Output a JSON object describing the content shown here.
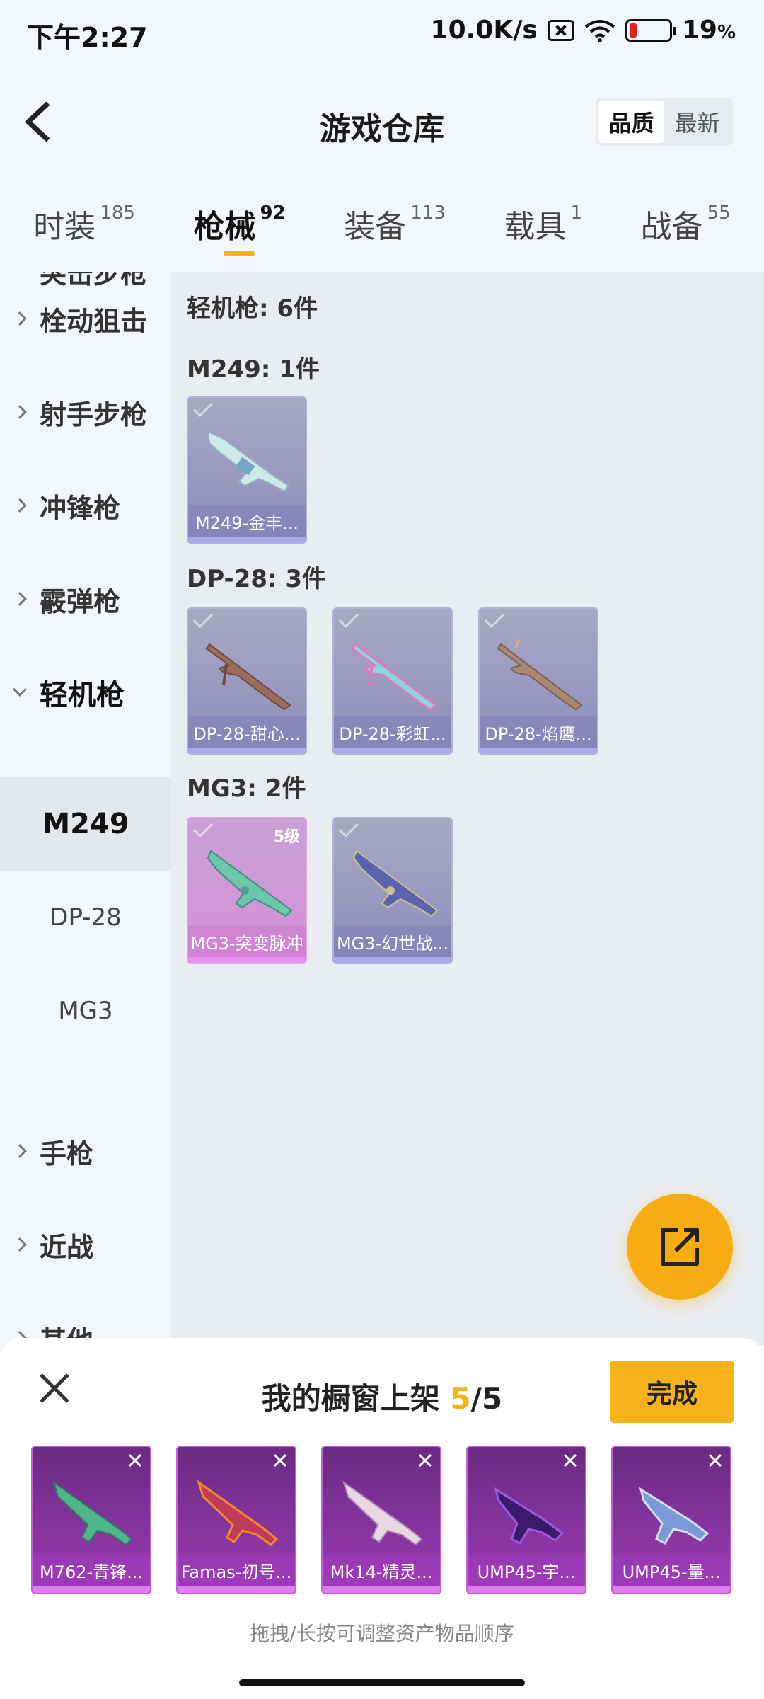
{
  "status_bar": {
    "time": "下午2:27",
    "speed": "10.0K/s",
    "battery": "19",
    "battery_unit": "%",
    "battery_level": 0.19
  },
  "header": {
    "title": "游戏仓库",
    "sort_options": [
      "品质",
      "最新"
    ],
    "sort_selected": "品质"
  },
  "tabs": [
    {
      "label": "时装",
      "count": "185",
      "active": false
    },
    {
      "label": "枪械",
      "count": "92",
      "active": true
    },
    {
      "label": "装备",
      "count": "113",
      "active": false
    },
    {
      "label": "载具",
      "count": "1",
      "active": false
    },
    {
      "label": "战备",
      "count": "55",
      "active": false
    }
  ],
  "sidebar": {
    "cut_item": "突击步枪",
    "items": [
      {
        "label": "栓动狙击"
      },
      {
        "label": "射手步枪"
      },
      {
        "label": "冲锋枪"
      },
      {
        "label": "霰弹枪"
      },
      {
        "label": "轻机枪"
      }
    ],
    "sub_items": [
      "M249",
      "DP-28",
      "MG3"
    ],
    "items_after": [
      {
        "label": "手枪"
      },
      {
        "label": "近战"
      },
      {
        "label": "其他"
      }
    ]
  },
  "main": {
    "category_header": "轻机枪: 6件",
    "groups": [
      {
        "header": "M249: 1件",
        "items": [
          {
            "label": "M249-金丰...",
            "quality": "purple"
          }
        ]
      },
      {
        "header": "DP-28: 3件",
        "items": [
          {
            "label": "DP-28-甜心...",
            "quality": "purple"
          },
          {
            "label": "DP-28-彩虹...",
            "quality": "purple"
          },
          {
            "label": "DP-28-焰鹰...",
            "quality": "purple"
          }
        ]
      },
      {
        "header": "MG3: 2件",
        "items": [
          {
            "label": "MG3-突变脉冲",
            "quality": "pink",
            "level": "5级"
          },
          {
            "label": "MG3-幻世战...",
            "quality": "purple"
          }
        ]
      }
    ]
  },
  "showcase": {
    "title": "我的橱窗上架 ",
    "count": "5",
    "total": "/5",
    "done_label": "完成",
    "items": [
      "M762-青锋...",
      "Famas-初号...",
      "Mk14-精灵...",
      "UMP45-宇...",
      "UMP45-量..."
    ],
    "hint": "拖拽/长按可调整资产物品顺序"
  },
  "colors": {
    "accent": "#f5b414",
    "done_button": "#f8b21b",
    "fab": "#f7ad12",
    "purple_card": "#8e8cbc",
    "pink_card": "#d58fd6",
    "showcase_card": "#9b3cb4"
  }
}
